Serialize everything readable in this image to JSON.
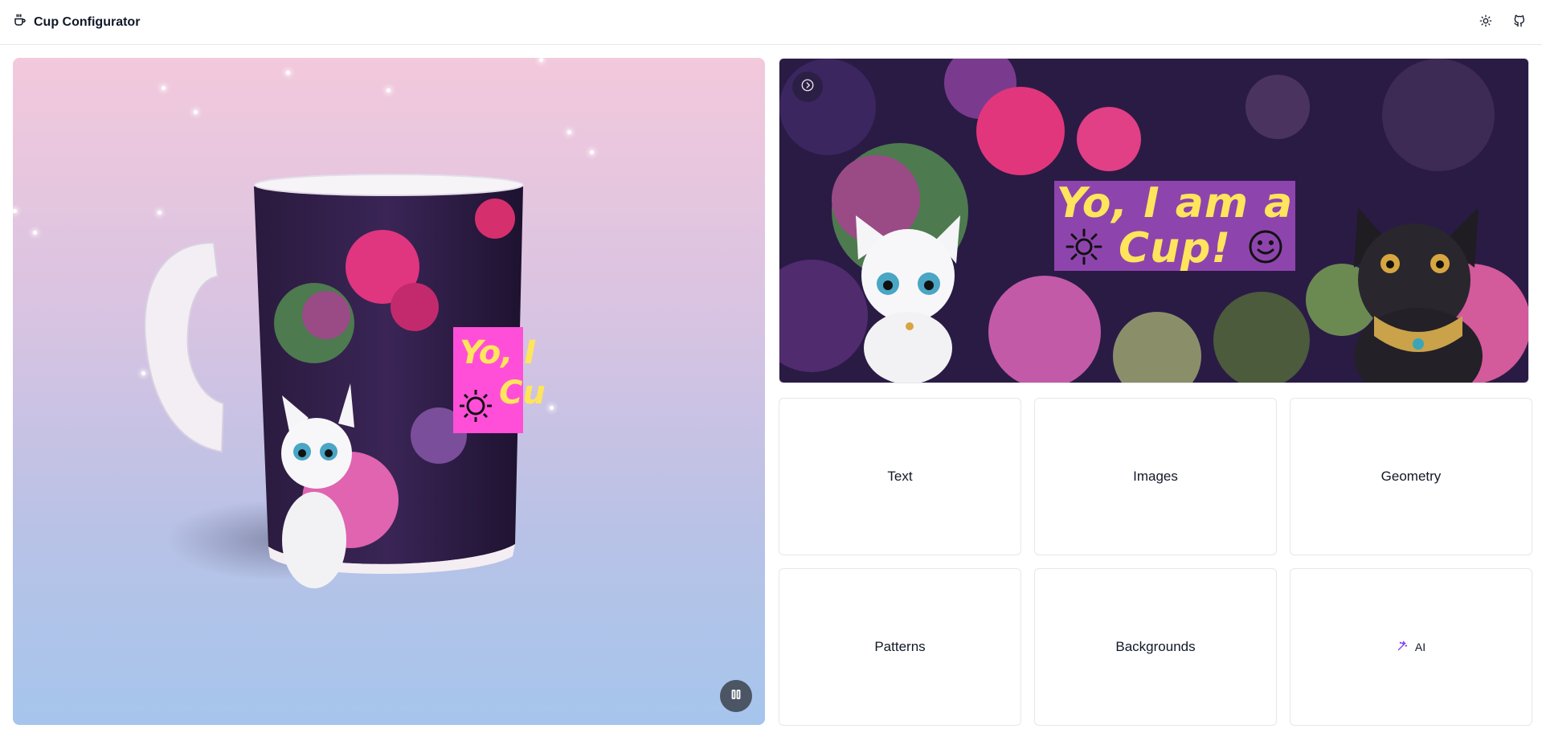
{
  "header": {
    "title": "Cup Configurator",
    "logo_icon": "coffee-cup-icon",
    "actions": [
      {
        "name": "theme-toggle",
        "icon": "sun-icon"
      },
      {
        "name": "github-link",
        "icon": "github-icon"
      }
    ]
  },
  "viewer": {
    "background_top": "#f3c9dc",
    "background_bottom": "#a6c5ec",
    "pause_icon": "pause-icon",
    "cup_label_lines": [
      "Yo, I",
      "Cu"
    ]
  },
  "preview": {
    "toggle_icon": "chevron-right-circle-icon",
    "banner_lines": [
      "Yo, I am a",
      "Cup!"
    ],
    "banner_color": "#8e44ad",
    "banner_text_color": "#ffe55c"
  },
  "tiles": {
    "text": "Text",
    "images": "Images",
    "geometry": "Geometry",
    "patterns": "Patterns",
    "backgrounds": "Backgrounds",
    "ai": "AI",
    "ai_icon": "magic-wand-icon",
    "ai_icon_color": "#7c3aed"
  }
}
